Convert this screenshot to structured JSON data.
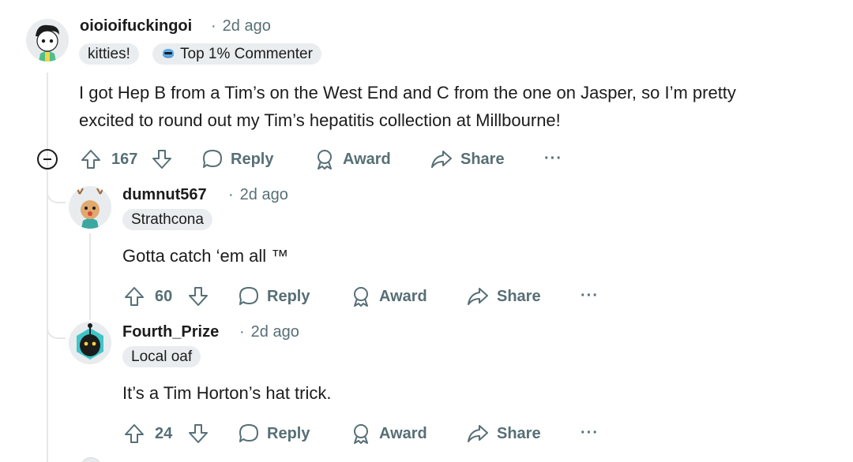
{
  "comments": [
    {
      "username": "oioioifuckingoi",
      "time": "2d ago",
      "flairs": [
        "kitties!"
      ],
      "badge": "Top 1% Commenter",
      "body_line1": "I got Hep B from a Tim’s on the West End and C from the one on Jasper, so I’m pretty",
      "body_line2": "excited to round out my Tim’s hepatitis collection at Millbourne!",
      "votes": "167",
      "reply": "Reply",
      "award": "Award",
      "share": "Share",
      "more": "···"
    },
    {
      "username": "dumnut567",
      "time": "2d ago",
      "flair": "Strathcona",
      "body": "Gotta catch ‘em all ™",
      "votes": "60",
      "reply": "Reply",
      "award": "Award",
      "share": "Share",
      "more": "···"
    },
    {
      "username": "Fourth_Prize",
      "time": "2d ago",
      "flair": "Local oaf",
      "body": "It’s a Tim Horton’s hat trick.",
      "votes": "24",
      "reply": "Reply",
      "award": "Award",
      "share": "Share",
      "more": "···"
    }
  ],
  "colors": {
    "meta": "#576f76",
    "flair_bg": "#eaedef",
    "thread_line": "#e5e7ea"
  }
}
